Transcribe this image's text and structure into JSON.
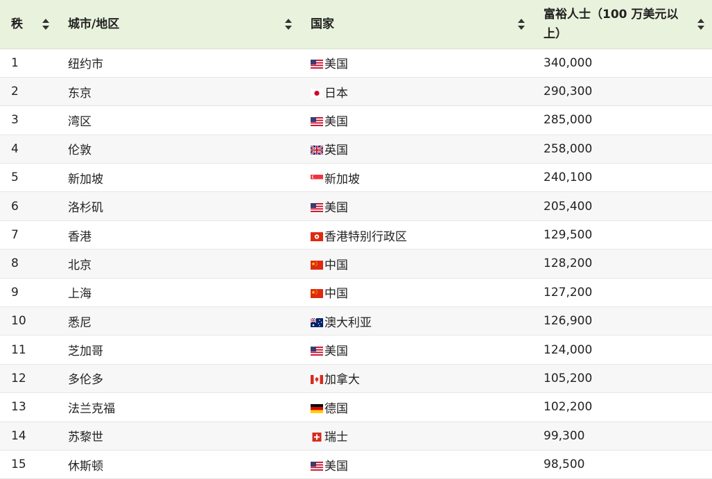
{
  "table": {
    "headers": {
      "rank": "秩",
      "city": "城市/地区",
      "country": "国家",
      "value": "富裕人士（100 万美元以上）"
    },
    "rows": [
      {
        "rank": "1",
        "city": "纽约市",
        "country": "美国",
        "flag": "us-flag-icon",
        "value": "340,000"
      },
      {
        "rank": "2",
        "city": "东京",
        "country": "日本",
        "flag": "japan-flag-icon",
        "value": "290,300"
      },
      {
        "rank": "3",
        "city": "湾区",
        "country": "美国",
        "flag": "us-flag-icon",
        "value": "285,000"
      },
      {
        "rank": "4",
        "city": "伦敦",
        "country": "英国",
        "flag": "uk-flag-icon",
        "value": "258,000"
      },
      {
        "rank": "5",
        "city": "新加坡",
        "country": "新加坡",
        "flag": "singapore-flag-icon",
        "value": "240,100"
      },
      {
        "rank": "6",
        "city": "洛杉矶",
        "country": "美国",
        "flag": "us-flag-icon",
        "value": "205,400"
      },
      {
        "rank": "7",
        "city": "香港",
        "country": "香港特别行政区",
        "flag": "hong-kong-flag-icon",
        "value": "129,500"
      },
      {
        "rank": "8",
        "city": "北京",
        "country": "中国",
        "flag": "china-flag-icon",
        "value": "128,200"
      },
      {
        "rank": "9",
        "city": "上海",
        "country": "中国",
        "flag": "china-flag-icon",
        "value": "127,200"
      },
      {
        "rank": "10",
        "city": "悉尼",
        "country": "澳大利亚",
        "flag": "australia-flag-icon",
        "value": "126,900"
      },
      {
        "rank": "11",
        "city": "芝加哥",
        "country": "美国",
        "flag": "us-flag-icon",
        "value": "124,000"
      },
      {
        "rank": "12",
        "city": "多伦多",
        "country": "加拿大",
        "flag": "canada-flag-icon",
        "value": "105,200"
      },
      {
        "rank": "13",
        "city": "法兰克福",
        "country": "德国",
        "flag": "germany-flag-icon",
        "value": "102,200"
      },
      {
        "rank": "14",
        "city": "苏黎世",
        "country": "瑞士",
        "flag": "switzerland-flag-icon",
        "value": "99,300"
      },
      {
        "rank": "15",
        "city": "休斯顿",
        "country": "美国",
        "flag": "us-flag-icon",
        "value": "98,500"
      }
    ]
  },
  "colors": {
    "header_bg": "#e9f2dc",
    "row_alt_bg": "#f7f7f7",
    "text": "#222222"
  }
}
